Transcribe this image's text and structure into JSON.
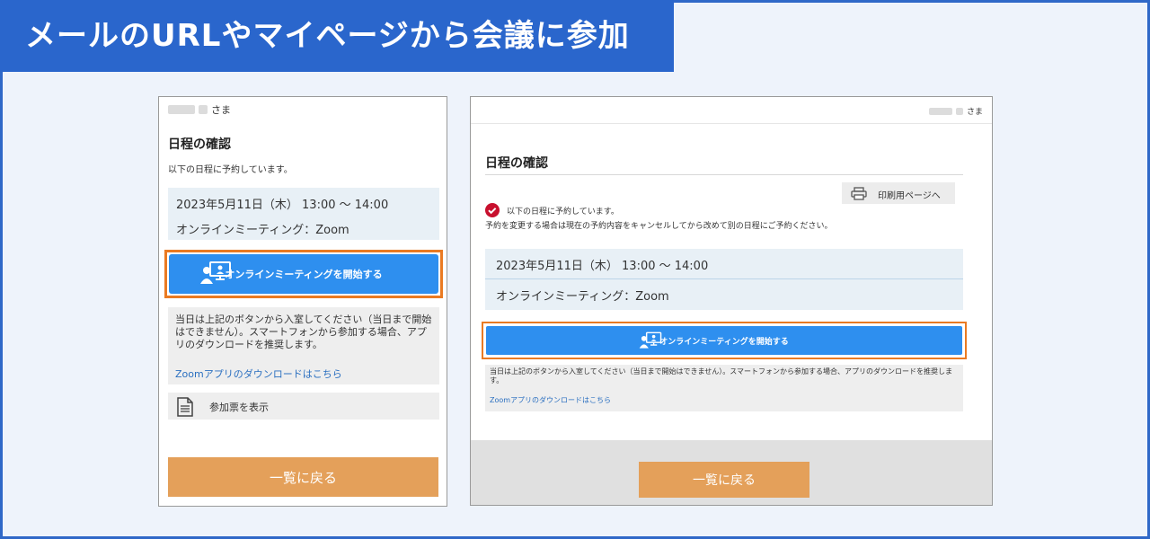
{
  "banner": {
    "title": "メールのURLやマイページから会議に参加"
  },
  "colors": {
    "accent": "#2a66cc",
    "button_blue": "#2e8fef",
    "highlight_orange": "#ea7a22",
    "back_button": "#e4a05a"
  },
  "mobile": {
    "user_suffix": "さま",
    "title": "日程の確認",
    "description": "以下の日程に予約しています。",
    "date": "2023年5月11日（木） 13:00 ～ 14:00",
    "meeting": "オンラインミーティング：Zoom",
    "start_button": "オンラインミーティングを開始する",
    "note": "当日は上記のボタンから入室してください（当日まで開始はできません）。スマートフォンから参加する場合、アプリのダウンロードを推奨します。",
    "download_link": "Zoomアプリのダウンロードはこちら",
    "ticket_button": "参加票を表示",
    "back_button": "一覧に戻る"
  },
  "desktop": {
    "user_suffix": "さま",
    "title": "日程の確認",
    "print_button": "印刷用ページへ",
    "message1": "以下の日程に予約しています。",
    "message2": "予約を変更する場合は現在の予約内容をキャンセルしてから改めて別の日程にご予約ください。",
    "date": "2023年5月11日（木） 13:00 ～ 14:00",
    "meeting": "オンラインミーティング：Zoom",
    "start_button": "オンラインミーティングを開始する",
    "note": "当日は上記のボタンから入室してください（当日まで開始はできません）。スマートフォンから参加する場合、アプリのダウンロードを推奨します。",
    "download_link": "Zoomアプリのダウンロードはこちら",
    "back_button": "一覧に戻る"
  }
}
